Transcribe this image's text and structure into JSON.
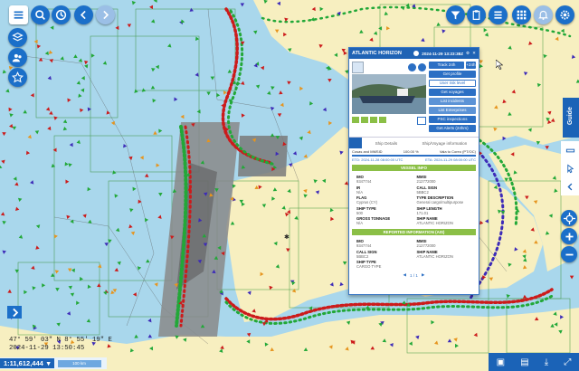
{
  "map": {
    "land_color": "#f7efc0",
    "sea_color": "#a9d7ec",
    "grid_color": "#2f8f2f",
    "scatter_marker": "✱"
  },
  "topbar": {
    "icons": [
      "search-icon",
      "clock-icon",
      "back-icon",
      "forward-icon"
    ]
  },
  "leftbar": {
    "icons": [
      "layers-icon",
      "group-icon",
      "star-icon"
    ]
  },
  "topright": {
    "icons": [
      "filter-icon",
      "clipboard-icon",
      "list-icon",
      "apps-icon",
      "bell-icon",
      "gear-icon"
    ]
  },
  "panel": {
    "title": "ATLANTIC HORIZON",
    "timestamp": "2024-11-29 13:23:38Z",
    "actions": {
      "track": "Track 24h",
      "plus24": "+24h",
      "profile": "Get profile",
      "user_risk": "User risk level",
      "voyages": "Get voyages",
      "incidents": "List incidents",
      "enterprises": "List Enterprises",
      "psc": "PSC inspections",
      "alerts": "Get Alerts (24hrs)"
    },
    "tabs": {
      "ship_details": "Ship Details",
      "voyage_info": "Ship/Voyage information"
    },
    "voyage": {
      "origin_label": "Cosas and  MMSID",
      "origin_date": "ETD: 2024-11-28 08:00:00 UTC",
      "progress_label": "100.00 %",
      "progress": 1.0,
      "dest_label": "Vala to Coreo (PT/OC)",
      "eta": "ETA: 2024-11-29 08:00:00 UTC"
    },
    "vessel_info": {
      "heading": "VESSEL INFO",
      "fields": [
        {
          "k": "IMO",
          "v": "9347744"
        },
        {
          "k": "MMSI",
          "v": "212772000"
        },
        {
          "k": "IR",
          "v": "N/A"
        },
        {
          "k": "CALL SIGN",
          "v": "5BBC2"
        },
        {
          "k": "FLAG",
          "v": "Cyprus (CY)"
        },
        {
          "k": "TYPE DESCRIPTION",
          "v": "General cargo/multipurpose"
        },
        {
          "k": "SHIP TYPE",
          "v": "500"
        },
        {
          "k": "SHIP LENGTH",
          "v": "171.01"
        },
        {
          "k": "GROSS TONNAGE",
          "v": "N/A"
        },
        {
          "k": "SHIP NAME",
          "v": "ATLANTIC HORIZON"
        }
      ]
    },
    "reported_info": {
      "heading": "REPORTED INFORMATION (AIS)",
      "fields": [
        {
          "k": "IMO",
          "v": "9347744"
        },
        {
          "k": "MMSI",
          "v": "212772000"
        },
        {
          "k": "CALL SIGN",
          "v": "5BBC2"
        },
        {
          "k": "SHIP NAME",
          "v": "ATLANTIC HORIZON"
        },
        {
          "k": "SHIP TYPE",
          "v": "CARGO TYPE"
        }
      ]
    },
    "pager": "1 / 1"
  },
  "status": {
    "coords": "47° 59' 03\" N  8° 55' 19\" E",
    "datetime": "2024-11-29 13:50:45",
    "zoom": "1:11,612,444",
    "scalebar": "100 km"
  },
  "guide_label": "Guide",
  "bottomright": {
    "icons": [
      "image-icon",
      "folder-icon",
      "download-icon",
      "expand-icon"
    ]
  }
}
